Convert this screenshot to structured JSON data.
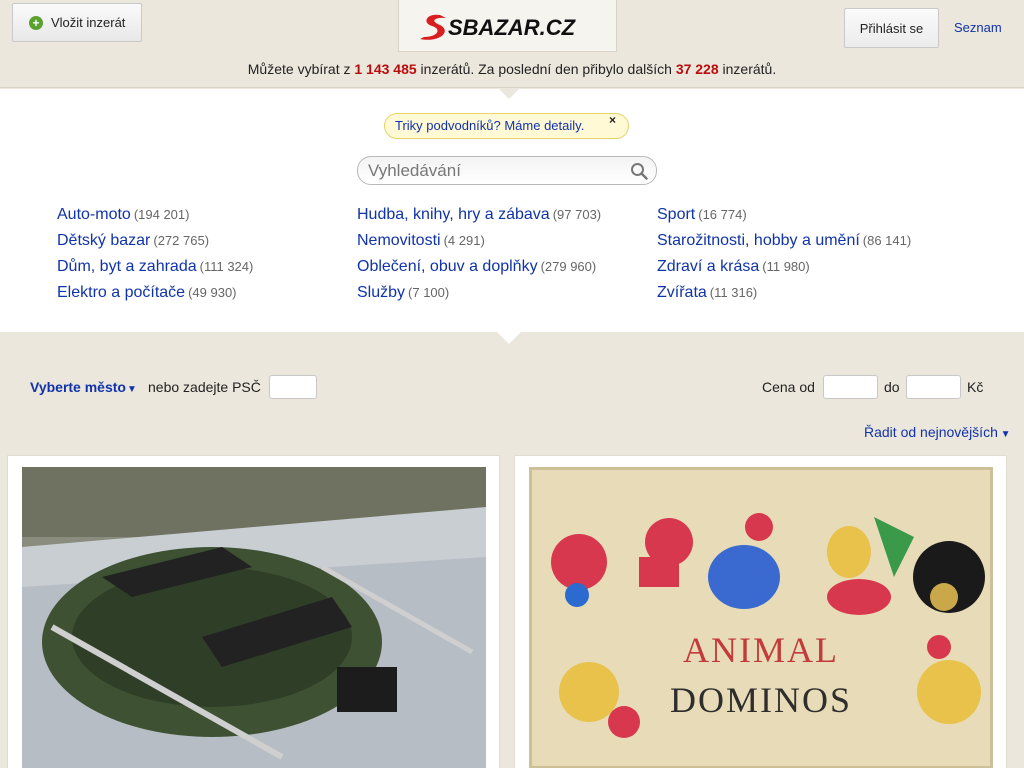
{
  "header": {
    "insert_button": "Vložit inzerát",
    "logo_text": "SBAZAR.CZ",
    "login_button": "Přihlásit se",
    "seznam_link": "Seznam"
  },
  "stats": {
    "prefix": "Můžete vybírat z ",
    "total": "1 143 485",
    "middle": " inzerátů. Za poslední den přibylo dalších ",
    "new_count": "37 228",
    "suffix": " inzerátů."
  },
  "notice": {
    "text": "Triky podvodníků? Máme detaily.",
    "close": "×"
  },
  "search": {
    "placeholder": "Vyhledávání"
  },
  "categories": {
    "col1": [
      {
        "label": "Auto-moto",
        "count": "(194 201)"
      },
      {
        "label": "Dětský bazar",
        "count": "(272 765)"
      },
      {
        "label": "Dům, byt a zahrada",
        "count": "(111 324)"
      },
      {
        "label": "Elektro a počítače",
        "count": "(49 930)"
      }
    ],
    "col2": [
      {
        "label": "Hudba, knihy, hry a zábava",
        "count": "(97 703)"
      },
      {
        "label": "Nemovitosti",
        "count": "(4 291)"
      },
      {
        "label": "Oblečení, obuv a doplňky",
        "count": "(279 960)"
      },
      {
        "label": "Služby",
        "count": "(7 100)"
      }
    ],
    "col3": [
      {
        "label": "Sport",
        "count": "(16 774)"
      },
      {
        "label": "Starožitnosti, hobby a umění",
        "count": "(86 141)"
      },
      {
        "label": "Zdraví a krása",
        "count": "(11 980)"
      },
      {
        "label": "Zvířata",
        "count": "(11 316)"
      }
    ]
  },
  "filters": {
    "city_label": "Vyberte město",
    "psc_label": "nebo zadejte PSČ",
    "price_from_label": "Cena od",
    "price_to_label": "do",
    "currency": "Kč",
    "sort_label": "Řadit od nejnovějších"
  },
  "listings": [
    {
      "image": "inflatable-boat-photo"
    },
    {
      "image": "animal-dominos-photo",
      "image_text_line1": "ANIMAL",
      "image_text_line2": "DOMINOS"
    }
  ],
  "colors": {
    "accent_red": "#b80d0d",
    "link_blue": "#1133aa",
    "background": "#ebe7dc"
  }
}
